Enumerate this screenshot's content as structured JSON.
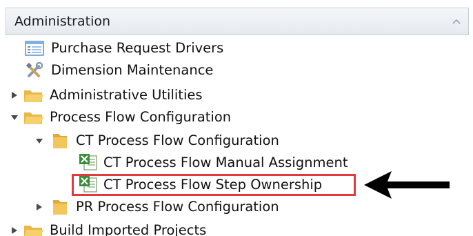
{
  "header": {
    "title": "Administration",
    "collapse_icon": "chevron-up-icon"
  },
  "tree": {
    "items": [
      {
        "label": "Purchase Request Drivers",
        "icon": "list-table-icon",
        "level": 0
      },
      {
        "label": "Dimension Maintenance",
        "icon": "tools-icon",
        "level": 0
      },
      {
        "label": "Administrative Utilities",
        "icon": "folder-open-icon",
        "level": 0,
        "expanded": false
      },
      {
        "label": "Process Flow Configuration",
        "icon": "folder-open-icon",
        "level": 0,
        "expanded": true
      },
      {
        "label": "CT Process Flow Configuration",
        "icon": "folder-yellow-icon",
        "level": 1,
        "expanded": true
      },
      {
        "label": "CT Process Flow Manual Assignment",
        "icon": "excel-icon",
        "level": 2
      },
      {
        "label": "CT Process Flow Step Ownership",
        "icon": "excel-icon",
        "level": 2,
        "highlighted": true
      },
      {
        "label": "PR Process Flow Configuration",
        "icon": "folder-yellow-icon",
        "level": 1,
        "expanded": false
      },
      {
        "label": "Build Imported Projects",
        "icon": "folder-open-icon",
        "level": 0,
        "expanded": false
      }
    ]
  },
  "annotation": {
    "highlight_color": "#e03a3a",
    "arrow_color": "#000000",
    "arrow_icon": "arrow-left-icon"
  }
}
